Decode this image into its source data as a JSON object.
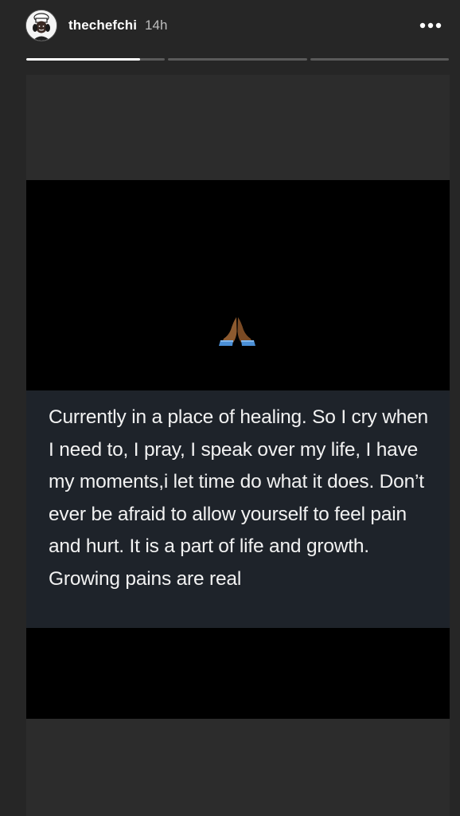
{
  "header": {
    "username": "thechefchi",
    "time_ago": "14h",
    "more_icon": "more-horizontal-icon",
    "avatar_icon": "chef-avatar-icon"
  },
  "progress": {
    "segments": [
      {
        "fill": 0.82
      },
      {
        "fill": 0
      },
      {
        "fill": 0
      }
    ]
  },
  "story": {
    "emoji": "folded-hands-icon",
    "text": "Currently in a place of healing. So I cry when I need to, I pray, I speak over my life, I have my moments,i let time do what it does. Don’t ever be afraid to allow yourself to feel pain and hurt. It is a part of life and growth. Growing pains are real"
  },
  "colors": {
    "background": "#262626",
    "media_black": "#000000",
    "text_panel": "#1e232a",
    "text": "#f2f2f2"
  }
}
